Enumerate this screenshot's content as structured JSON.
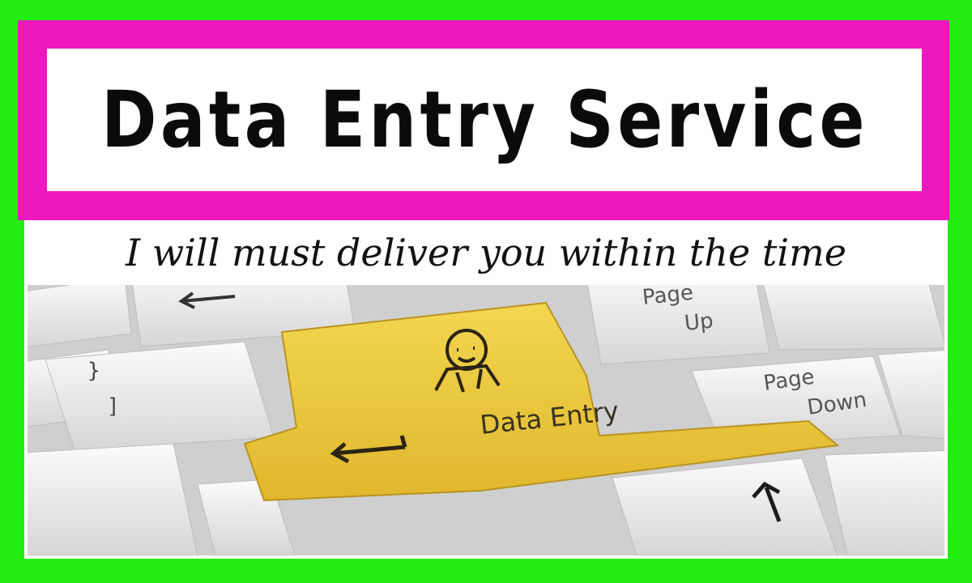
{
  "title": "Data Entry Service",
  "tagline": "I will must deliver you within the time",
  "keyboard": {
    "main_key_label": "Data Entry",
    "page_up_line1": "Page",
    "page_up_line2": "Up",
    "page_down_line1": "Page",
    "page_down_line2": "Down",
    "bracket_key_top": "}",
    "bracket_key_bottom": "]",
    "icons": [
      "person-icon",
      "enter-arrow-icon",
      "left-arrow-icon",
      "up-arrow-icon"
    ],
    "main_key_color": "#ecc73a"
  },
  "colors": {
    "outer_border": "#22ee11",
    "title_frame": "#ee18c0",
    "title_text": "#0b0b0b"
  }
}
